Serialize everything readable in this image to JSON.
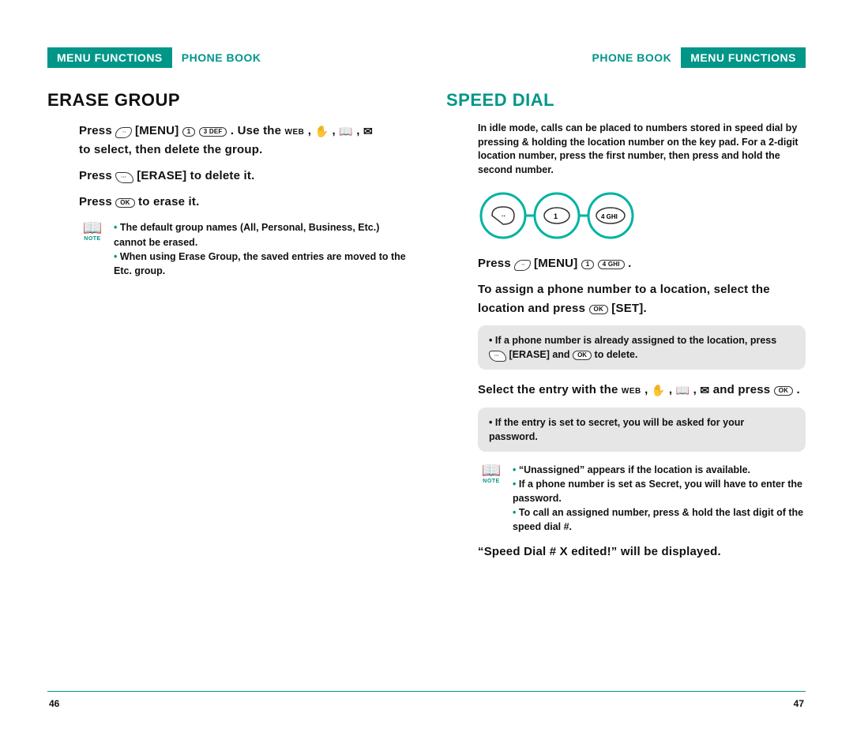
{
  "left": {
    "tab": "MENU FUNCTIONS",
    "crumb": "PHONE BOOK",
    "title": "ERASE GROUP",
    "line1_a": "Press",
    "line1_menu": "[MENU]",
    "line1_b": ". Use the",
    "line1_c": "to select, then delete the group.",
    "line2_a": "Press",
    "line2_b": "[ERASE] to delete it.",
    "line3_a": "Press",
    "line3_b": "to erase it.",
    "note1": "The default group names (All, Personal, Business, Etc.) cannot be erased.",
    "note2": "When using Erase Group, the saved entries are moved to the Etc. group.",
    "page": "46"
  },
  "right": {
    "tab": "MENU FUNCTIONS",
    "crumb": "PHONE BOOK",
    "title": "SPEED DIAL",
    "intro": "In idle mode, calls can be placed to numbers stored in speed dial by pressing & holding the location number on the key pad. For a 2-digit location number, press the first number, then press and hold the second number.",
    "lineA_a": "Press",
    "lineA_menu": "[MENU]",
    "lineA_b": ".",
    "lineB": "To assign a phone number to a location, select the location and press",
    "lineB_set": "[SET].",
    "box1_a": "If a phone number is already assigned to the location, press",
    "box1_erase": "[ERASE] and",
    "box1_b": "to delete.",
    "lineC_a": "Select the entry with the",
    "lineC_b": "and press",
    "lineC_c": ".",
    "box2": "If the entry is set to secret, you will be asked for your password.",
    "noteR1": "“Unassigned” appears if the location is available.",
    "noteR2": "If a phone number is set as Secret, you will have to enter the password.",
    "noteR3": "To call an assigned number, press & hold the last digit of the speed dial #.",
    "final": "“Speed Dial # X edited!” will be displayed.",
    "page": "47",
    "circle_key1": "1",
    "circle_key2": "4 GHI",
    "key_ok": "OK",
    "key_1": "1",
    "key_3": "3 DEF",
    "key_4": "4 GHI",
    "web": "WEB"
  }
}
